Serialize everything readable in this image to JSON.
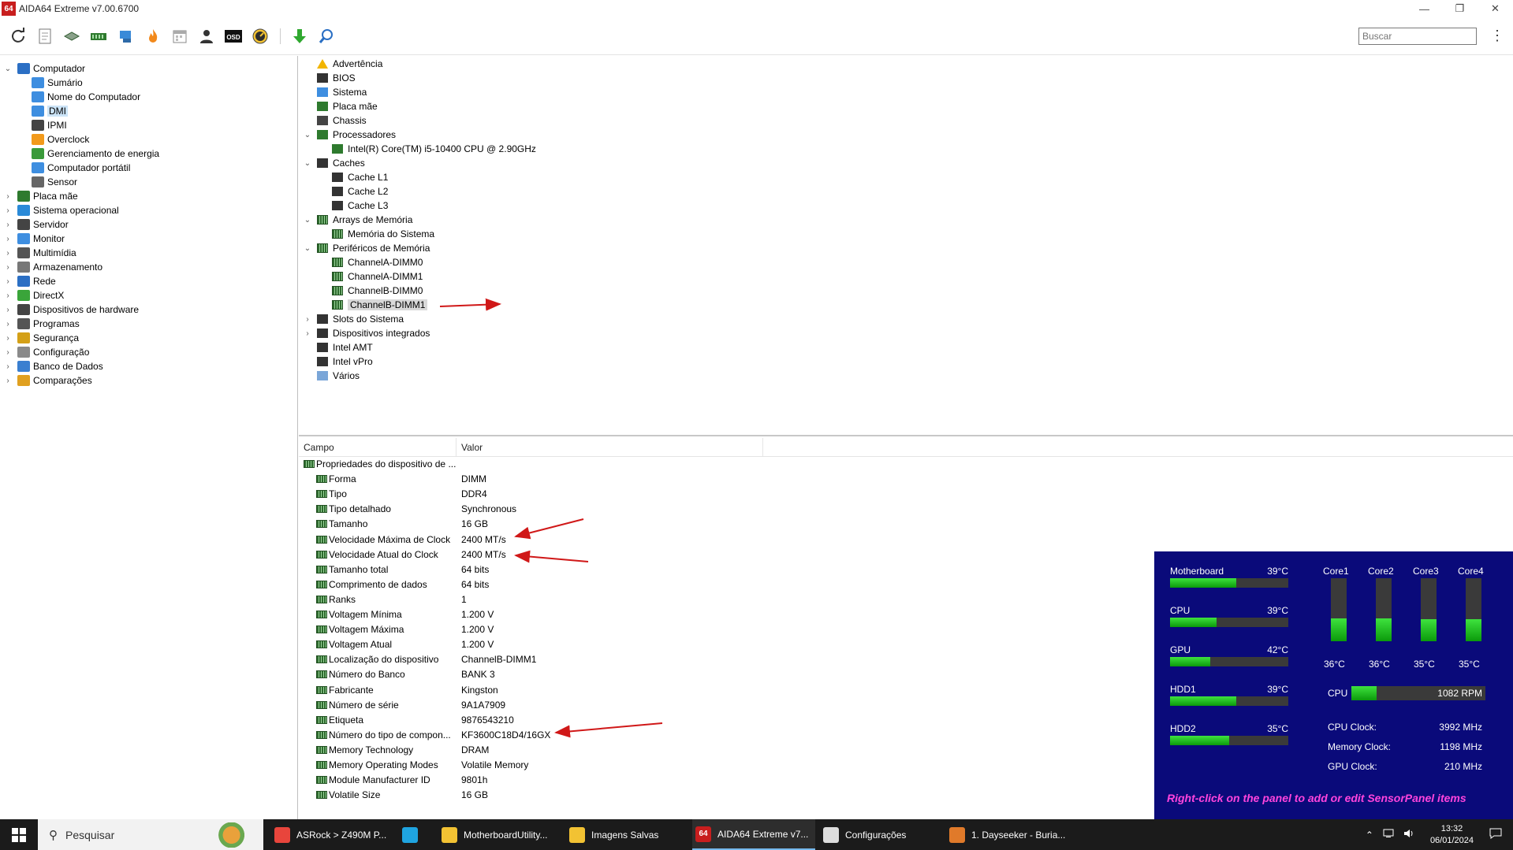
{
  "window": {
    "app_icon_text": "64",
    "title": "AIDA64 Extreme v7.00.6700",
    "min_glyph": "—",
    "max_glyph": "❐",
    "close_glyph": "✕"
  },
  "toolbar": {
    "icons": [
      "refresh-icon",
      "report-icon",
      "motherboard-icon",
      "memory-icon",
      "network-icon",
      "flame-icon",
      "calendar-icon",
      "user-icon",
      "osd-icon",
      "speedometer-icon",
      "download-arrow-icon",
      "search-magnifier-icon"
    ],
    "osd_text": "OSD",
    "search_placeholder": "Buscar",
    "more_glyph": "⋮"
  },
  "left_tree": [
    {
      "label": "Computador",
      "level": 0,
      "expander": "⌄",
      "icon": "#2b6fc4"
    },
    {
      "label": "Sumário",
      "level": 1,
      "expander": "",
      "icon": "#3e8ee0"
    },
    {
      "label": "Nome do Computador",
      "level": 1,
      "expander": "",
      "icon": "#3e8ee0"
    },
    {
      "label": "DMI",
      "level": 1,
      "expander": "",
      "icon": "#3e8ee0",
      "selected": true
    },
    {
      "label": "IPMI",
      "level": 1,
      "expander": "",
      "icon": "#444444"
    },
    {
      "label": "Overclock",
      "level": 1,
      "expander": "",
      "icon": "#f29a1b"
    },
    {
      "label": "Gerenciamento de energia",
      "level": 1,
      "expander": "",
      "icon": "#3a9a3a"
    },
    {
      "label": "Computador portátil",
      "level": 1,
      "expander": "",
      "icon": "#3e8ee0"
    },
    {
      "label": "Sensor",
      "level": 1,
      "expander": "",
      "icon": "#666666"
    },
    {
      "label": "Placa mãe",
      "level": 0,
      "expander": "›",
      "icon": "#2e7a2e"
    },
    {
      "label": "Sistema operacional",
      "level": 0,
      "expander": "›",
      "icon": "#2a8ad8"
    },
    {
      "label": "Servidor",
      "level": 0,
      "expander": "›",
      "icon": "#444444"
    },
    {
      "label": "Monitor",
      "level": 0,
      "expander": "›",
      "icon": "#3e8ee0"
    },
    {
      "label": "Multimídia",
      "level": 0,
      "expander": "›",
      "icon": "#555555"
    },
    {
      "label": "Armazenamento",
      "level": 0,
      "expander": "›",
      "icon": "#777777"
    },
    {
      "label": "Rede",
      "level": 0,
      "expander": "›",
      "icon": "#2b6fc4"
    },
    {
      "label": "DirectX",
      "level": 0,
      "expander": "›",
      "icon": "#3aa53a"
    },
    {
      "label": "Dispositivos de hardware",
      "level": 0,
      "expander": "›",
      "icon": "#444444"
    },
    {
      "label": "Programas",
      "level": 0,
      "expander": "›",
      "icon": "#555555"
    },
    {
      "label": "Segurança",
      "level": 0,
      "expander": "›",
      "icon": "#d4a017"
    },
    {
      "label": "Configuração",
      "level": 0,
      "expander": "›",
      "icon": "#8a8a8a"
    },
    {
      "label": "Banco de Dados",
      "level": 0,
      "expander": "›",
      "icon": "#3a7fd0"
    },
    {
      "label": "Comparações",
      "level": 0,
      "expander": "›",
      "icon": "#e0a020"
    }
  ],
  "right_tree": [
    {
      "label": "Advertência",
      "level": 0,
      "expander": "",
      "icon": "#f2b500"
    },
    {
      "label": "BIOS",
      "level": 0,
      "expander": "",
      "icon": "#333333"
    },
    {
      "label": "Sistema",
      "level": 0,
      "expander": "",
      "icon": "#3e8ee0"
    },
    {
      "label": "Placa mãe",
      "level": 0,
      "expander": "",
      "icon": "#2e7a2e"
    },
    {
      "label": "Chassis",
      "level": 0,
      "expander": "",
      "icon": "#444444"
    },
    {
      "label": "Processadores",
      "level": 0,
      "expander": "⌄",
      "icon": "#2e7a2e"
    },
    {
      "label": "Intel(R) Core(TM) i5-10400 CPU @ 2.90GHz",
      "level": 1,
      "expander": "",
      "icon": "#2e7a2e"
    },
    {
      "label": "Caches",
      "level": 0,
      "expander": "⌄",
      "icon": "#333333"
    },
    {
      "label": "Cache L1",
      "level": 1,
      "expander": "",
      "icon": "#333333"
    },
    {
      "label": "Cache L2",
      "level": 1,
      "expander": "",
      "icon": "#333333"
    },
    {
      "label": "Cache L3",
      "level": 1,
      "expander": "",
      "icon": "#333333"
    },
    {
      "label": "Arrays de Memória",
      "level": 0,
      "expander": "⌄",
      "icon": "ram"
    },
    {
      "label": "Memória do Sistema",
      "level": 1,
      "expander": "",
      "icon": "ram"
    },
    {
      "label": "Periféricos de Memória",
      "level": 0,
      "expander": "⌄",
      "icon": "ram"
    },
    {
      "label": "ChannelA-DIMM0",
      "level": 1,
      "expander": "",
      "icon": "ram"
    },
    {
      "label": "ChannelA-DIMM1",
      "level": 1,
      "expander": "",
      "icon": "ram"
    },
    {
      "label": "ChannelB-DIMM0",
      "level": 1,
      "expander": "",
      "icon": "ram"
    },
    {
      "label": "ChannelB-DIMM1",
      "level": 1,
      "expander": "",
      "icon": "ram",
      "selected": true
    },
    {
      "label": "Slots do Sistema",
      "level": 0,
      "expander": "›",
      "icon": "#333333"
    },
    {
      "label": "Dispositivos integrados",
      "level": 0,
      "expander": "›",
      "icon": "#333333"
    },
    {
      "label": "Intel AMT",
      "level": 0,
      "expander": "",
      "icon": "#333333"
    },
    {
      "label": "Intel vPro",
      "level": 0,
      "expander": "",
      "icon": "#333333"
    },
    {
      "label": "Vários",
      "level": 0,
      "expander": "",
      "icon": "#7aa6d8"
    }
  ],
  "properties": {
    "col_field": "Campo",
    "col_value": "Valor",
    "rows": [
      {
        "field": "Propriedades do dispositivo de ...",
        "value": "",
        "group": true
      },
      {
        "field": "Forma",
        "value": "DIMM"
      },
      {
        "field": "Tipo",
        "value": "DDR4"
      },
      {
        "field": "Tipo detalhado",
        "value": "Synchronous"
      },
      {
        "field": "Tamanho",
        "value": "16 GB"
      },
      {
        "field": "Velocidade Máxima de Clock",
        "value": "2400 MT/s"
      },
      {
        "field": "Velocidade Atual do Clock",
        "value": "2400 MT/s"
      },
      {
        "field": "Tamanho total",
        "value": "64 bits"
      },
      {
        "field": "Comprimento de dados",
        "value": "64 bits"
      },
      {
        "field": "Ranks",
        "value": "1"
      },
      {
        "field": "Voltagem Mínima",
        "value": "1.200 V"
      },
      {
        "field": "Voltagem Máxima",
        "value": "1.200 V"
      },
      {
        "field": "Voltagem Atual",
        "value": "1.200 V"
      },
      {
        "field": "Localização do dispositivo",
        "value": "ChannelB-DIMM1"
      },
      {
        "field": "Número do Banco",
        "value": "BANK 3"
      },
      {
        "field": "Fabricante",
        "value": "Kingston"
      },
      {
        "field": "Número de série",
        "value": "9A1A7909"
      },
      {
        "field": "Etiqueta",
        "value": "9876543210"
      },
      {
        "field": "Número do tipo de compon...",
        "value": "KF3600C18D4/16GX"
      },
      {
        "field": "Memory Technology",
        "value": "DRAM"
      },
      {
        "field": "Memory Operating Modes",
        "value": "Volatile Memory"
      },
      {
        "field": "Module Manufacturer ID",
        "value": "9801h"
      },
      {
        "field": "Volatile Size",
        "value": "16 GB"
      }
    ]
  },
  "sensor_panel": {
    "colors": {
      "background": "#0a0a7a",
      "bar_fill": "#22c322",
      "bar_track": "#3a3a3a",
      "footer": "#ff44dd"
    },
    "left_sensors": [
      {
        "name": "Motherboard",
        "value": "39°C",
        "level": 0.56
      },
      {
        "name": "CPU",
        "value": "39°C",
        "level": 0.39
      },
      {
        "name": "GPU",
        "value": "42°C",
        "level": 0.34
      },
      {
        "name": "HDD1",
        "value": "39°C",
        "level": 0.56
      },
      {
        "name": "HDD2",
        "value": "35°C",
        "level": 0.5
      }
    ],
    "cores": [
      {
        "name": "Core1",
        "value": "36°C",
        "level": 0.36
      },
      {
        "name": "Core2",
        "value": "36°C",
        "level": 0.36
      },
      {
        "name": "Core3",
        "value": "35°C",
        "level": 0.35
      },
      {
        "name": "Core4",
        "value": "35°C",
        "level": 0.35
      }
    ],
    "fan": {
      "name": "CPU",
      "value": "1082 RPM",
      "level": 0.19
    },
    "clocks": [
      {
        "name": "CPU Clock:",
        "value": "3992 MHz"
      },
      {
        "name": "Memory Clock:",
        "value": "1198 MHz"
      },
      {
        "name": "GPU Clock:",
        "value": "210 MHz"
      }
    ],
    "footer": "Right-click on the panel to add or edit SensorPanel items"
  },
  "taskbar": {
    "search_placeholder": "Pesquisar",
    "items": [
      {
        "label": "ASRock > Z490M P...",
        "icon": "#e8453c",
        "name": "chrome-icon"
      },
      {
        "label": "",
        "icon": "#1fa4e0",
        "name": "edge-icon"
      },
      {
        "label": "MotherboardUtility...",
        "icon": "#f2c233",
        "name": "folder-icon"
      },
      {
        "label": "Imagens Salvas",
        "icon": "#f2c233",
        "name": "folder-icon"
      },
      {
        "label": "AIDA64 Extreme v7...",
        "icon": "#c81e1e",
        "name": "aida64-icon",
        "active": true,
        "icon_text": "64"
      },
      {
        "label": "Configurações",
        "icon": "#dddddd",
        "name": "gear-icon"
      },
      {
        "label": "1. Dayseeker - Buria...",
        "icon": "#e07a2a",
        "name": "winamp-icon"
      }
    ],
    "tray": {
      "chevron": "⌃",
      "time": "13:32",
      "date": "06/01/2024"
    }
  }
}
